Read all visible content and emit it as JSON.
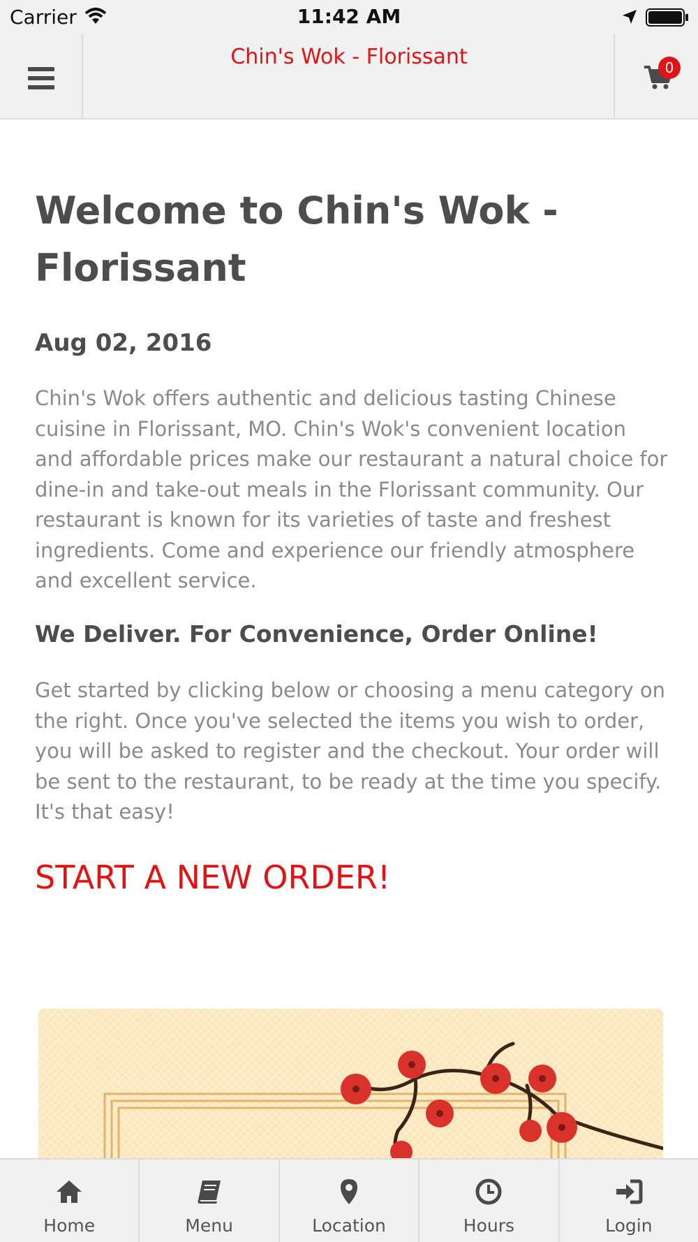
{
  "status_bar": {
    "carrier": "Carrier",
    "time": "11:42 AM"
  },
  "navbar": {
    "title": "Chin's Wok - Florissant",
    "cart_count": "0"
  },
  "content": {
    "title": "Welcome to Chin's Wok - Florissant",
    "date": "Aug 02, 2016",
    "intro": "Chin's Wok offers authentic and delicious tasting Chinese cuisine in Florissant, MO. Chin's Wok's convenient location and affordable prices make our restaurant a natural choice for dine-in and take-out meals in the Florissant community. Our restaurant is known for its varieties of taste and freshest ingredients. Come and experience our friendly atmosphere and excellent service.",
    "deliver_heading": "We Deliver. For Convenience, Order Online!",
    "instructions": "Get started by clicking below or choosing a menu category on the right. Once you've selected the items you wish to order, you will be asked to register and the checkout. Your order will be sent to the restaurant, to be ready at the time you specify. It's that easy!",
    "start_order": "START A NEW ORDER!"
  },
  "tabs": [
    {
      "label": "Home",
      "icon": "home-icon"
    },
    {
      "label": "Menu",
      "icon": "book-icon"
    },
    {
      "label": "Location",
      "icon": "map-marker-icon"
    },
    {
      "label": "Hours",
      "icon": "clock-icon"
    },
    {
      "label": "Login",
      "icon": "sign-in-icon"
    }
  ],
  "colors": {
    "accent": "#e01414",
    "bar_bg": "#f1f1f1",
    "heading": "#4d4d4d",
    "body_text": "#8a8a8a"
  }
}
